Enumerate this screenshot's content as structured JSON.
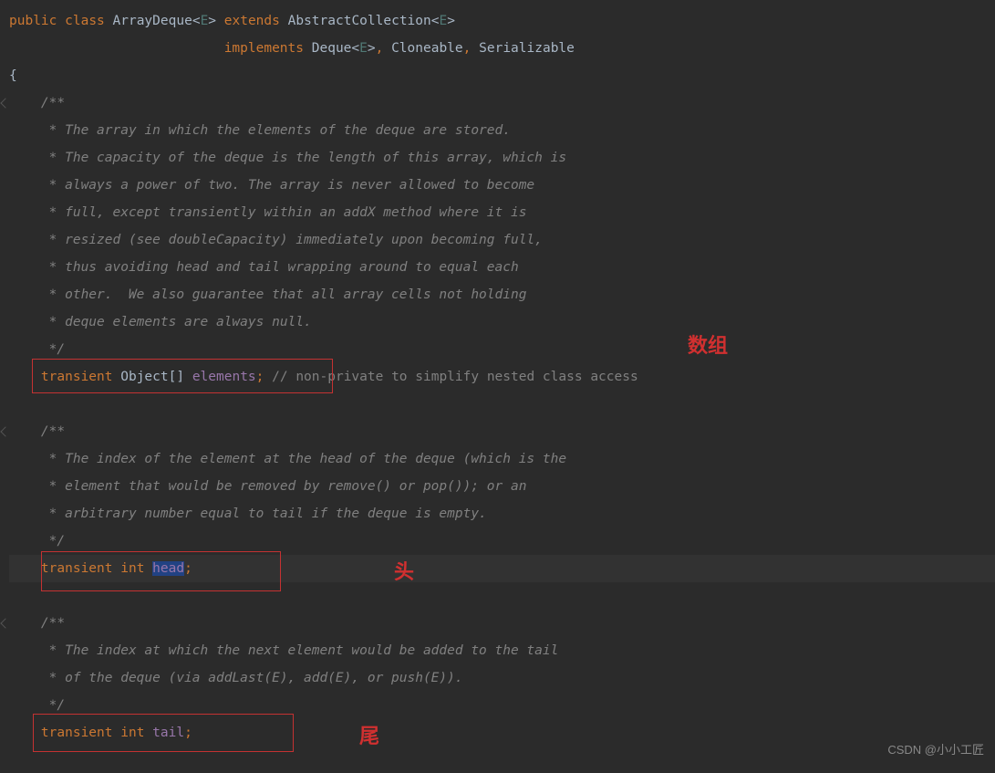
{
  "code": {
    "l1_public": "public",
    "l1_class": "class",
    "l1_name": "ArrayDeque",
    "l1_genE": "E",
    "l1_extends": "extends",
    "l1_super": "AbstractCollection",
    "l2_implements": "implements",
    "l2_deque": "Deque",
    "l2_cloneable": "Cloneable",
    "l2_serial": "Serializable",
    "l3_brace": "{",
    "c1_open": "/**",
    "c1_l1": " * The array in which the elements of the deque are stored.",
    "c1_l2": " * The capacity of the deque is the length of this array, which is",
    "c1_l3": " * always a power of two. The array is never allowed to become",
    "c1_l4": " * full, except transiently within an addX method where it is",
    "c1_l5": " * resized (see doubleCapacity) immediately upon becoming full,",
    "c1_l6": " * thus avoiding head and tail wrapping around to equal each",
    "c1_l7": " * other.  We also guarantee that all array cells not holding",
    "c1_l8": " * deque elements are always null.",
    "c1_close": " */",
    "f1_transient": "transient",
    "f1_type": "Object[]",
    "f1_name": "elements",
    "f1_comment": "// non-private to simplify nested class access",
    "c2_open": "/**",
    "c2_l1": " * The index of the element at the head of the deque (which is the",
    "c2_l2": " * element that would be removed by remove() or pop()); or an",
    "c2_l3": " * arbitrary number equal to tail if the deque is empty.",
    "c2_close": " */",
    "f2_transient": "transient",
    "f2_type": "int",
    "f2_name": "head",
    "c3_open": "/**",
    "c3_l1": " * The index at which the next element would be added to the tail",
    "c3_l2": " * of the deque (via addLast(E), add(E), or push(E)).",
    "c3_close": " */",
    "f3_transient": "transient",
    "f3_type": "int",
    "f3_name": "tail"
  },
  "annotations": {
    "array": "数组",
    "head": "头",
    "tail": "尾"
  },
  "watermark": "CSDN @小小工匠"
}
